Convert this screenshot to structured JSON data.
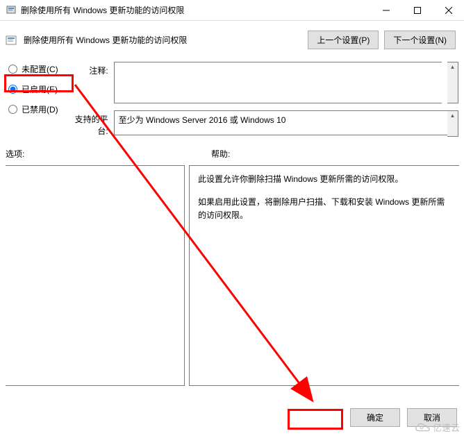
{
  "window": {
    "title": "删除使用所有 Windows 更新功能的访问权限"
  },
  "header": {
    "title": "删除使用所有 Windows 更新功能的访问权限",
    "prev_button": "上一个设置(P)",
    "next_button": "下一个设置(N)"
  },
  "radio": {
    "not_configured": "未配置(C)",
    "enabled": "已启用(E)",
    "disabled": "已禁用(D)",
    "selected": "enabled"
  },
  "fields": {
    "comment_label": "注释:",
    "comment_value": "",
    "platform_label": "支持的平台:",
    "platform_value": "至少为 Windows Server 2016 或 Windows 10"
  },
  "labels": {
    "options": "选项:",
    "help": "帮助:"
  },
  "help": {
    "line1": "此设置允许你删除扫描 Windows 更新所需的访问权限。",
    "line2": "如果启用此设置，将删除用户扫描、下载和安装 Windows 更新所需的访问权限。"
  },
  "buttons": {
    "ok": "确定",
    "cancel": "取消"
  },
  "watermark": {
    "text": "亿速云"
  }
}
